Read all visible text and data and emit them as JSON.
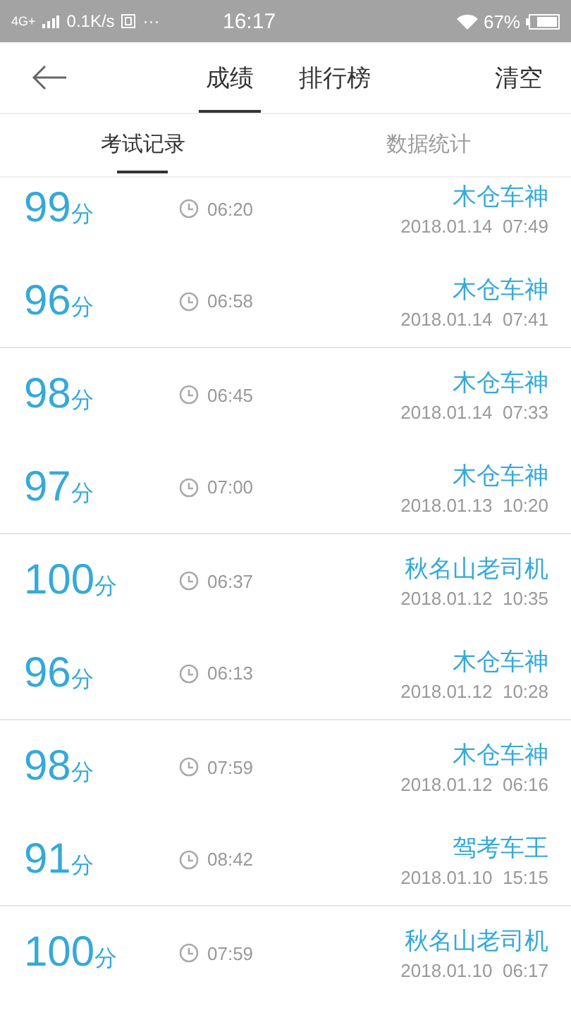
{
  "status_bar": {
    "network": "4G+",
    "speed": "0.1K/s",
    "more": "···",
    "time": "16:17",
    "battery": "67%"
  },
  "header": {
    "tabs": [
      {
        "label": "成绩",
        "selected": true
      },
      {
        "label": "排行榜",
        "selected": false
      }
    ],
    "action": "清空"
  },
  "subtabs": [
    {
      "label": "考试记录",
      "selected": true
    },
    {
      "label": "数据统计",
      "selected": false
    }
  ],
  "records": [
    {
      "score": "99",
      "unit": "分",
      "duration": "06:20",
      "name": "木仓车神",
      "date": "2018.01.14  07:49"
    },
    {
      "score": "96",
      "unit": "分",
      "duration": "06:58",
      "name": "木仓车神",
      "date": "2018.01.14  07:41"
    },
    {
      "score": "98",
      "unit": "分",
      "duration": "06:45",
      "name": "木仓车神",
      "date": "2018.01.14  07:33"
    },
    {
      "score": "97",
      "unit": "分",
      "duration": "07:00",
      "name": "木仓车神",
      "date": "2018.01.13  10:20"
    },
    {
      "score": "100",
      "unit": "分",
      "duration": "06:37",
      "name": "秋名山老司机",
      "date": "2018.01.12  10:35"
    },
    {
      "score": "96",
      "unit": "分",
      "duration": "06:13",
      "name": "木仓车神",
      "date": "2018.01.12  10:28"
    },
    {
      "score": "98",
      "unit": "分",
      "duration": "07:59",
      "name": "木仓车神",
      "date": "2018.01.12  06:16"
    },
    {
      "score": "91",
      "unit": "分",
      "duration": "08:42",
      "name": "驾考车王",
      "date": "2018.01.10  15:15"
    },
    {
      "score": "100",
      "unit": "分",
      "duration": "07:59",
      "name": "秋名山老司机",
      "date": "2018.01.10  06:17"
    }
  ]
}
